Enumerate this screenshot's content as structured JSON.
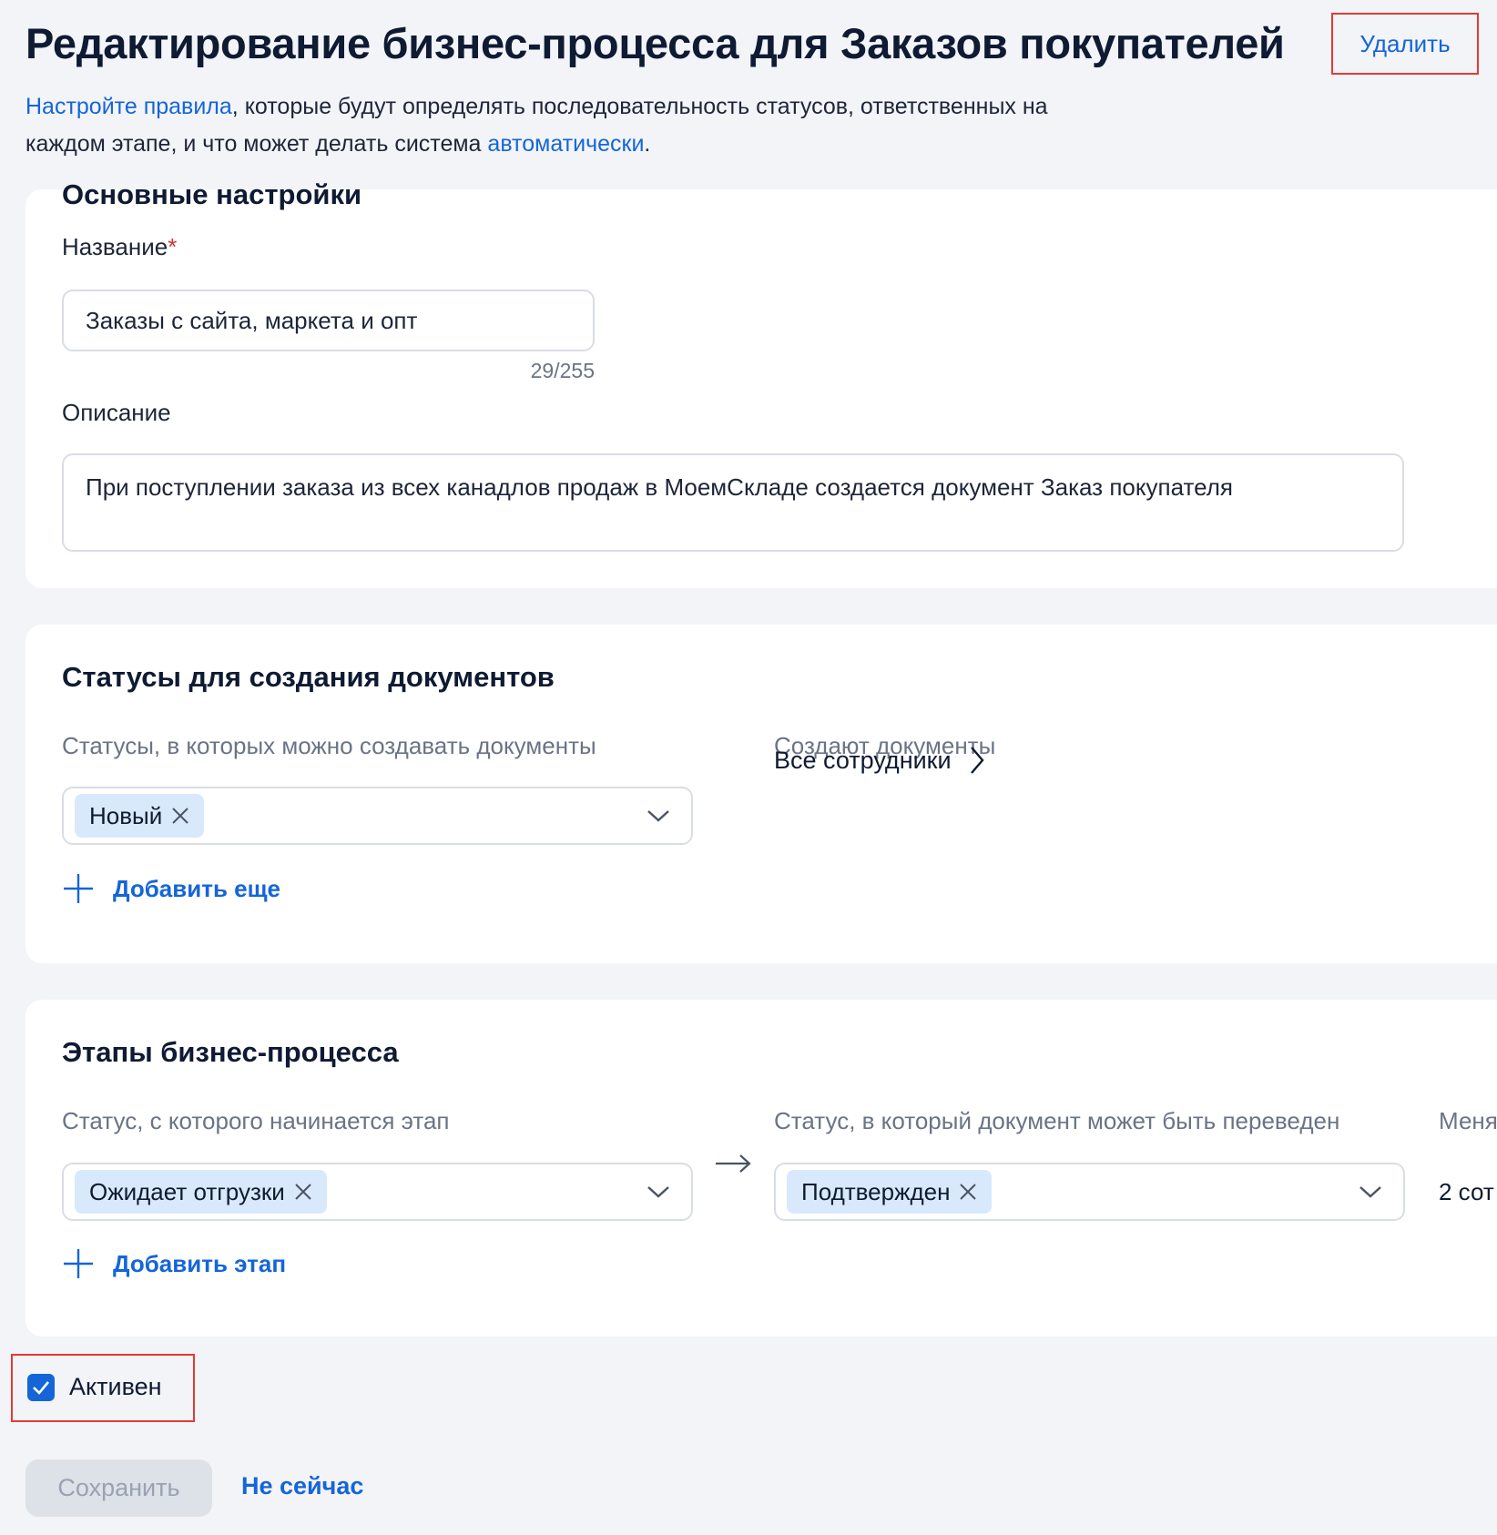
{
  "header": {
    "title": "Редактирование бизнес-процесса для Заказов покупателей",
    "delete_label": "Удалить"
  },
  "intro": {
    "link1": "Настройте правила",
    "text1": ", которые будут определять последовательность статусов, ответственных на каждом этапе, и что может делать система ",
    "link2": "автоматически",
    "text2": "."
  },
  "main_settings": {
    "title": "Основные настройки",
    "name_label": "Название",
    "required_mark": "*",
    "name_value": "Заказы с сайта, маркета и опт",
    "name_counter": "29/255",
    "description_label": "Описание",
    "description_value": "При поступлении заказа из всех канадлов продаж в МоемСкладе создается документ Заказ покупателя"
  },
  "doc_statuses": {
    "title": "Статусы для создания документов",
    "statuses_label": "Статусы, в которых можно создавать документы",
    "creators_label": "Создают документы",
    "selected_status": "Новый",
    "creators_value": "Все сотрудники",
    "add_more_label": "Добавить еще"
  },
  "stages": {
    "title": "Этапы бизнес-процесса",
    "from_label": "Статус, с которого начинается этап",
    "to_label": "Статус, в который документ может быть переведен",
    "third_label_partial": "Меня",
    "from_status": "Ожидает отгрузки",
    "to_status": "Подтвержден",
    "third_value_partial": "2 сот",
    "add_stage_label": "Добавить этап"
  },
  "active": {
    "label": "Активен",
    "checked": true
  },
  "footer": {
    "save_label": "Сохранить",
    "not_now_label": "Не сейчас"
  },
  "colors": {
    "accent": "#1565d8",
    "chip_bg": "#d8e9fb",
    "highlight_border": "#e53935",
    "background": "#f2f4f8"
  }
}
